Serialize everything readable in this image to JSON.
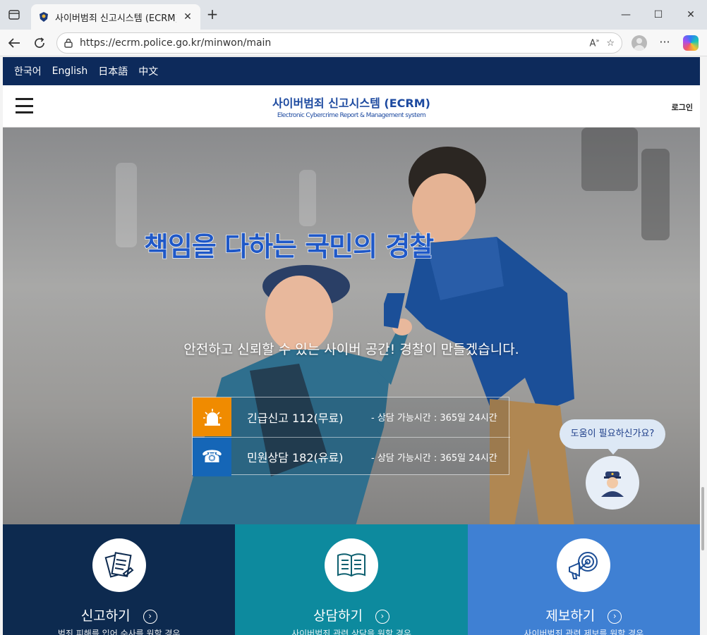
{
  "browser": {
    "tab_title": "사이버범죄 신고시스템 (ECRM)",
    "tab_close": "✕",
    "new_tab": "+",
    "url": "https://ecrm.police.go.kr/minwon/main",
    "window_controls": {
      "minimize": "—",
      "maximize": "☐",
      "close": "✕"
    },
    "more": "···"
  },
  "site": {
    "languages": [
      "한국어",
      "English",
      "日本語",
      "中文"
    ],
    "brand_korean": "사이버범죄 신고시스템 (ECRM)",
    "brand_english": "Electronic Cybercrime Report & Management system",
    "login": "로그인"
  },
  "hero": {
    "headline": "책임을 다하는 국민의 경찰",
    "subtitle": "안전하고 신뢰할 수 있는 사이버 공간! 경찰이 만들겠습니다.",
    "rows": [
      {
        "label": "긴급신고 112(무료)",
        "hours": "- 상담 가능시간 : 365일 24시간",
        "color": "#f08b00",
        "icon": "siren-icon"
      },
      {
        "label": "민원상담 182(유료)",
        "hours": "- 상담 가능시간 : 365일 24시간",
        "color": "#1566b7",
        "icon": "phone-icon"
      }
    ],
    "help_bubble": "도움이 필요하신가요?"
  },
  "cards": [
    {
      "title": "신고하기",
      "description": "범죄 피해를 입어 수사를 원할 경우",
      "color": "#0d2a4f",
      "icon": "report-document-icon"
    },
    {
      "title": "상담하기",
      "description": "사이버범죄 관련 상담을 원할 경우",
      "color": "#0d8a9e",
      "icon": "book-icon"
    },
    {
      "title": "제보하기",
      "description": "사이버범죄 관련 제보를 원할 경우",
      "color": "#3f80d3",
      "icon": "megaphone-target-icon"
    }
  ]
}
